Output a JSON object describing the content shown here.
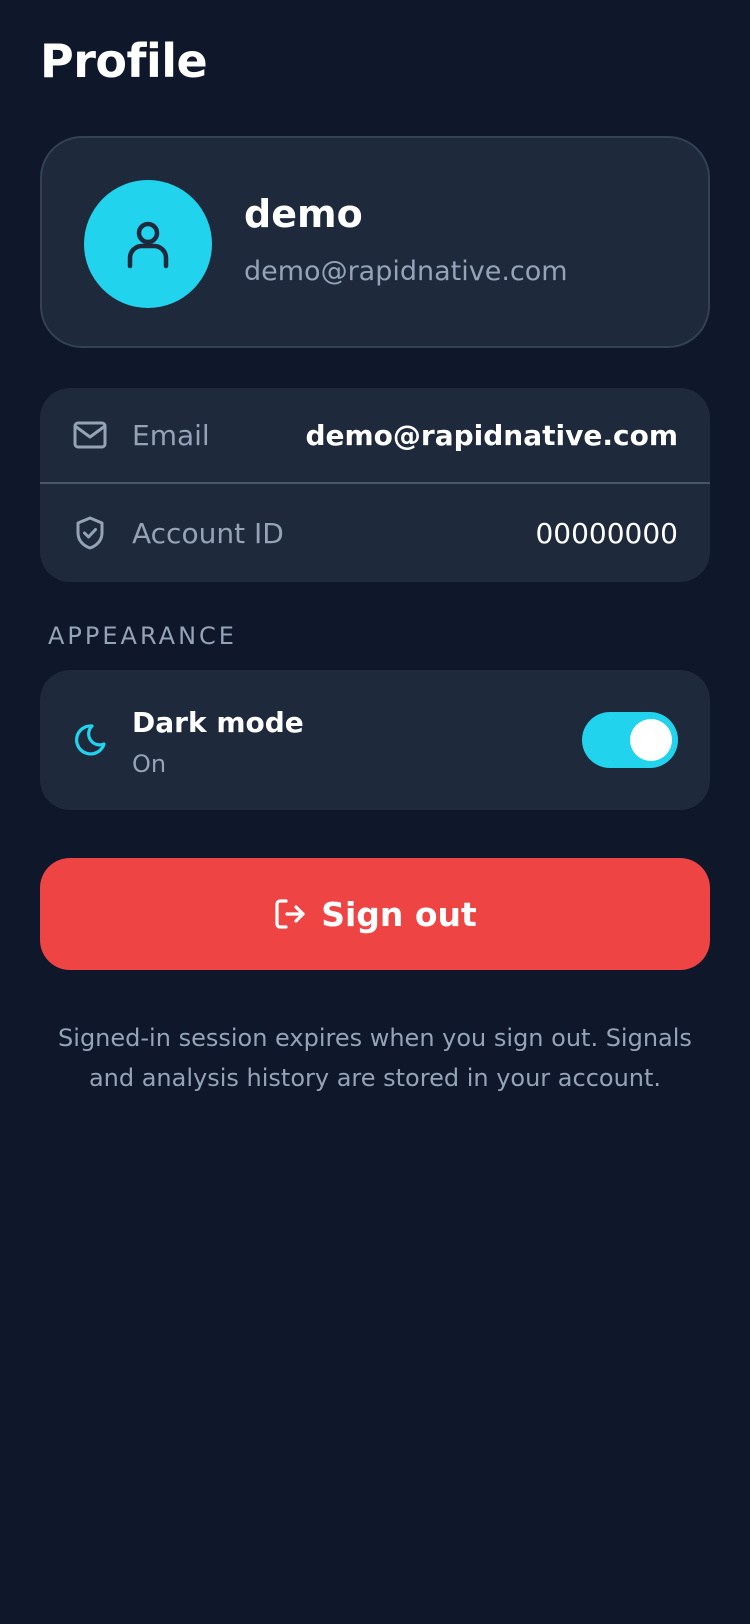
{
  "header": {
    "title": "Profile"
  },
  "profile": {
    "name": "demo",
    "email": "demo@rapidnative.com",
    "avatar_icon": "user-icon"
  },
  "account_info": {
    "rows": [
      {
        "icon": "mail-icon",
        "label": "Email",
        "value": "demo@rapidnative.com"
      },
      {
        "icon": "shield-check-icon",
        "label": "Account ID",
        "value": "00000000"
      }
    ]
  },
  "appearance": {
    "section_label": "APPEARANCE",
    "dark_mode": {
      "icon": "moon-icon",
      "title": "Dark mode",
      "status": "On",
      "enabled": true
    }
  },
  "actions": {
    "sign_out_label": "Sign out",
    "sign_out_icon": "log-out-icon"
  },
  "footer_note": "Signed-in session expires when you sign out. Signals and analysis history are stored in your account.",
  "colors": {
    "background": "#0f172a",
    "card": "#1e293b",
    "accent": "#22d3ee",
    "danger": "#ef4444",
    "muted_text": "#94a3b8"
  }
}
